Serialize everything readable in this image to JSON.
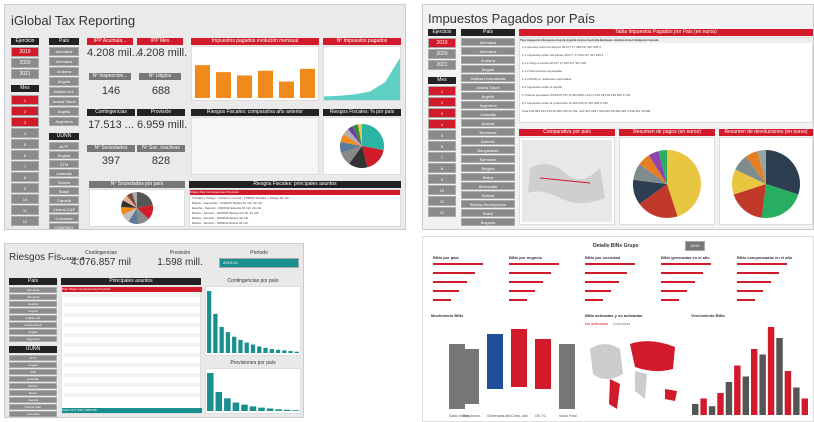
{
  "p1": {
    "title": "iGlobal Tax Reporting",
    "ejercicio": "Ejercicio",
    "pais": "País",
    "years": [
      "2019",
      "2020",
      "2021"
    ],
    "paises": [
      "Alemania",
      "Alemania",
      "Andorra",
      "Angola",
      "Antillas Hol.",
      "Arabia Saudí",
      "Argelia",
      "Argentina"
    ],
    "mes": "Mes",
    "meses": [
      "1",
      "2",
      "3",
      "4",
      "5",
      "6",
      "7",
      "8",
      "9",
      "10",
      "11",
      "12"
    ],
    "uunn": "UUNN",
    "uunn_items": [
      "ALTF",
      "Angola",
      "ATM",
      "Australia",
      "Bolivia",
      "Brasil",
      "Canadá",
      "Central G&F",
      "Colombia",
      "COMPANY"
    ],
    "ipp_acum": "IPP Acumula...",
    "ipp_acum_val": "4.208 mil...",
    "ipp_mes": "IPP Mes",
    "ipp_mes_val": "4.208 mill.",
    "inspecciones": "Nº Inspeccion...",
    "inspecciones_val": "146",
    "litigios": "Nº Litigios",
    "litigios_val": "688",
    "contingencias": "Contingencias",
    "contingencias_val": "17.513 ...",
    "provision": "Provisión",
    "provision_val": "6.959 mill.",
    "sociedades": "Nº Sociedades",
    "sociedades_val": "397",
    "soc_inact": "Nº Soc. inactivas",
    "soc_inact_val": "828",
    "chart1": "Impuestos pagados evolución mensual",
    "chart2": "Nº Impuestos pagados",
    "chart3": "Riesgos Fiscales: comparativa año anterior",
    "chart4": "Riesgos Fiscales: % por país",
    "chart5": "Nº Sociedades por país",
    "chart6": "Riesgos Fiscales: principales asuntos",
    "tbl_cols": [
      "Objeto",
      "País",
      "Contingencias",
      "Provisión"
    ],
    "tbl_rows": [
      [
        "Trinidad y Tobago - Gobierno Central - TTB000",
        "Trinidad y Tobago",
        "50 mill.",
        ""
      ],
      [
        "Bolivia - Ganancias - 0000007",
        "Bolivia",
        "40 mill.",
        "40 mill."
      ],
      [
        "España - Sanción - 0000002",
        "España",
        "40 mill.",
        "40 mill."
      ],
      [
        "Bolivia - Sanción - 0000005",
        "Bolivia",
        "33 mill.",
        "33 mill."
      ],
      [
        "Bolivia - Sanción - 0000010",
        "Bolivia",
        "30 mill.",
        ""
      ],
      [
        "Bolivia - Sanción - 0000011",
        "Bolivia",
        "28 mill.",
        ""
      ]
    ]
  },
  "p2": {
    "title": "Impuestos Pagados por País",
    "ejercicio": "Ejercicio",
    "pais": "País",
    "mes": "Mes",
    "years": [
      "2019",
      "2020",
      "2021"
    ],
    "paises": [
      "Alemania",
      "Alemania",
      "Andorra",
      "Angola",
      "Antillas Holandesas",
      "Arabia Saudí",
      "Argelia",
      "Argentina",
      "Australia",
      "Austria",
      "Bahamas",
      "Bahrein",
      "Bangladesh",
      "Barbados",
      "Bélgica",
      "Belice",
      "Bermudas",
      "Bolivia",
      "Bosnia-Herzegovina",
      "Brasil",
      "Bulgaria"
    ],
    "meses": [
      "1",
      "2",
      "3",
      "4",
      "5",
      "6",
      "7",
      "8",
      "9",
      "10",
      "11",
      "12"
    ],
    "table_title": "Tabla Impuestos Pagados por País (en euros)",
    "cols": [
      "Tipo Impuesto",
      "Alemania",
      "Angola",
      "Argelia",
      "Aruba",
      "Australia",
      "Barbados",
      "Bolivia",
      "Brasil",
      "Bulgaria",
      "Canadá"
    ],
    "rows": [
      [
        "1 Impuestos sobre beneficios",
        "40.077",
        "",
        "17.420.117",
        "",
        "",
        "327.229",
        "",
        "",
        "",
        "4"
      ],
      [
        "1.1 Impuestos sobre beneficios",
        "40.077",
        "",
        "17.420.117",
        "",
        "",
        "327.229",
        "",
        "",
        "",
        "4"
      ],
      [
        "1.1.1 Pago a cuenta",
        "40.077",
        "",
        "17.420.117",
        "",
        "",
        "327.229",
        "",
        "",
        "",
        ""
      ],
      [
        "1.1.2 Retenciones soportadas",
        "",
        "",
        "",
        "",
        "",
        "",
        "",
        "",
        "",
        ""
      ],
      [
        "1.1.3 IRNR no residentes soportadas",
        "",
        "",
        "",
        "",
        "",
        "",
        "",
        "",
        "",
        ""
      ],
      [
        "1.2 Impuestos sobre el capital",
        "",
        "",
        "",
        "",
        "",
        "",
        "",
        "",
        "",
        ""
      ],
      [
        "2 Tributos asociados",
        "63.834",
        "8.767",
        "11.804.868",
        "1.101",
        "",
        "1.576.243",
        "66.159.969",
        "",
        "",
        "5.716"
      ],
      [
        "2.1 Impuestos sobre la producción",
        "",
        "",
        "11.926.426",
        "",
        "",
        "",
        "37.467.905",
        "",
        "",
        "2.346"
      ],
      [
        "Total",
        "234.994",
        "104.319",
        "30.050.706",
        "43.792",
        "-123",
        "327.229",
        "7.629.022",
        "63.399.422",
        "2.349.421",
        "15.996"
      ]
    ],
    "c1": "Comparativa por país",
    "c2": "Resumen de pagos (en euros)",
    "c3": "Resumen de devoluciones (en euros)"
  },
  "p3": {
    "title": "Riesgos Fiscales",
    "contingencias": "Contingencias",
    "contingencias_val": "4.076.857 mil",
    "provision": "Provisión",
    "provision_val": "1.598 mill.",
    "periodo": "Período",
    "periodo_val": "2019-04",
    "pais": "País",
    "uunn": "UUNN",
    "paises": [
      "Alemania",
      "Alemania",
      "Andorra",
      "Angola",
      "Antillas Hol.",
      "Arabia Saudí",
      "Argelia",
      "Argentina"
    ],
    "uunn_items": [
      "ALTF",
      "Angola",
      "ATM",
      "Australia",
      "Bolivia",
      "Brasil",
      "Canadá",
      "Central G&F",
      "Colombia"
    ],
    "table_title": "Principales asuntos",
    "cols": [
      "País",
      "Objeto",
      "Contingencias",
      "Provisión"
    ],
    "chart1": "Contingencias por país",
    "chart2": "Provisiones por país",
    "total_label": "Total",
    "total_contingencias": "4.077.348",
    "total_provision": "1.598.425"
  },
  "p4": {
    "header": "Detalle BINs Grupo",
    "year": "2019",
    "k1": "BINs por país",
    "k2": "BINs por negocio",
    "k3": "BINs por sociedad",
    "k4": "BINs generadas en el año",
    "k5": "BINs compensadas en el año",
    "c1": "Movimiento BINs",
    "c2": "BINs activadas y no activadas",
    "c3": "Vencimiento BINs",
    "wf_labels": [
      "Saldo Inicial",
      "Regulariza.",
      "Generadas año",
      "Comp. año",
      "Otr. TC",
      "Saldo Final"
    ],
    "legend_act": "No activadas",
    "legend_noact": "Activadas"
  },
  "chart_data": [
    {
      "type": "bar",
      "title": "Impuestos pagados evolución mensual",
      "categories": [
        "1",
        "2",
        "3",
        "4",
        "5",
        "6"
      ],
      "values": [
        70,
        55,
        48,
        58,
        35,
        62
      ],
      "ylim": [
        0,
        100
      ]
    },
    {
      "type": "area",
      "title": "Nº Impuestos pagados",
      "x": [
        1,
        2,
        3,
        4,
        5,
        6
      ],
      "values": [
        5,
        6,
        8,
        12,
        25,
        60
      ],
      "ylim": [
        0,
        70
      ]
    },
    {
      "type": "pie",
      "title": "Riesgos Fiscales: % por país",
      "values": [
        28,
        18,
        14,
        10,
        8,
        6,
        5,
        4,
        4,
        3
      ]
    },
    {
      "type": "pie",
      "title": "Nº Sociedades por país",
      "values": [
        22,
        15,
        12,
        10,
        9,
        8,
        7,
        6,
        6,
        5
      ]
    },
    {
      "type": "bar",
      "title": "Contingencias por país",
      "values": [
        95,
        60,
        40,
        32,
        25,
        20,
        16,
        13,
        10,
        8,
        6,
        5,
        4,
        3,
        2
      ]
    },
    {
      "type": "bar",
      "title": "Provisiones por país",
      "values": [
        90,
        45,
        30,
        20,
        15,
        11,
        8,
        6,
        4,
        3,
        2
      ]
    },
    {
      "type": "bar",
      "title": "Vencimiento BINs",
      "values": [
        10,
        15,
        8,
        20,
        30,
        45,
        35,
        60,
        55,
        80,
        70,
        40,
        25,
        15
      ]
    }
  ]
}
